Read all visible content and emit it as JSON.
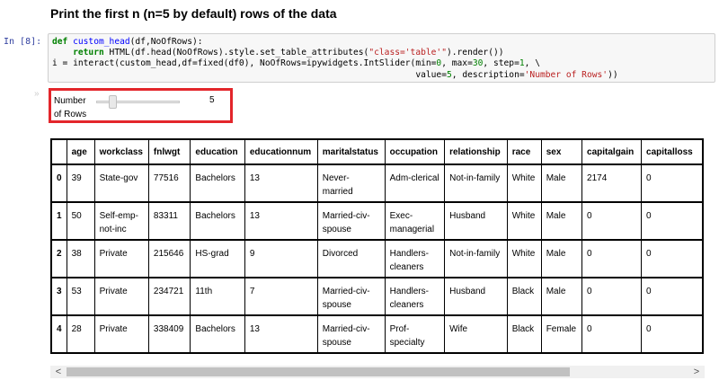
{
  "heading": "Print the first n (n=5 by default) rows of the data",
  "cell": {
    "prompt": "In [8]:",
    "code_lines": [
      "def custom_head(df,NoOfRows):",
      "    return HTML(df.head(NoOfRows).style.set_table_attributes(\"class='table'\").render())",
      "i = interact(custom_head,df=fixed(df0), NoOfRows=ipywidgets.IntSlider(min=0, max=30, step=1, \\",
      "                                                                      value=5, description='Number of Rows'))"
    ]
  },
  "output": {
    "marker": "»"
  },
  "slider": {
    "description_line1": "Number",
    "description_line2": "of Rows",
    "min": 0,
    "max": 30,
    "value": 5,
    "value_label": "5",
    "highlight_color": "#e3262b"
  },
  "table": {
    "columns": [
      "",
      "age",
      "workclass",
      "fnlwgt",
      "education",
      "educationnum",
      "maritalstatus",
      "occupation",
      "relationship",
      "race",
      "sex",
      "capitalgain",
      "capitalloss"
    ],
    "rows": [
      [
        "0",
        "39",
        "State-gov",
        "77516",
        "Bachelors",
        "13",
        "Never-married",
        "Adm-clerical",
        "Not-in-family",
        "White",
        "Male",
        "2174",
        "0"
      ],
      [
        "1",
        "50",
        "Self-emp-not-inc",
        "83311",
        "Bachelors",
        "13",
        "Married-civ-spouse",
        "Exec-managerial",
        "Husband",
        "White",
        "Male",
        "0",
        "0"
      ],
      [
        "2",
        "38",
        "Private",
        "215646",
        "HS-grad",
        "9",
        "Divorced",
        "Handlers-cleaners",
        "Not-in-family",
        "White",
        "Male",
        "0",
        "0"
      ],
      [
        "3",
        "53",
        "Private",
        "234721",
        "11th",
        "7",
        "Married-civ-spouse",
        "Handlers-cleaners",
        "Husband",
        "Black",
        "Male",
        "0",
        "0"
      ],
      [
        "4",
        "28",
        "Private",
        "338409",
        "Bachelors",
        "13",
        "Married-civ-spouse",
        "Prof-specialty",
        "Wife",
        "Black",
        "Female",
        "0",
        "0"
      ]
    ]
  },
  "scrollbar": {
    "left_arrow": "<",
    "right_arrow": ">"
  }
}
